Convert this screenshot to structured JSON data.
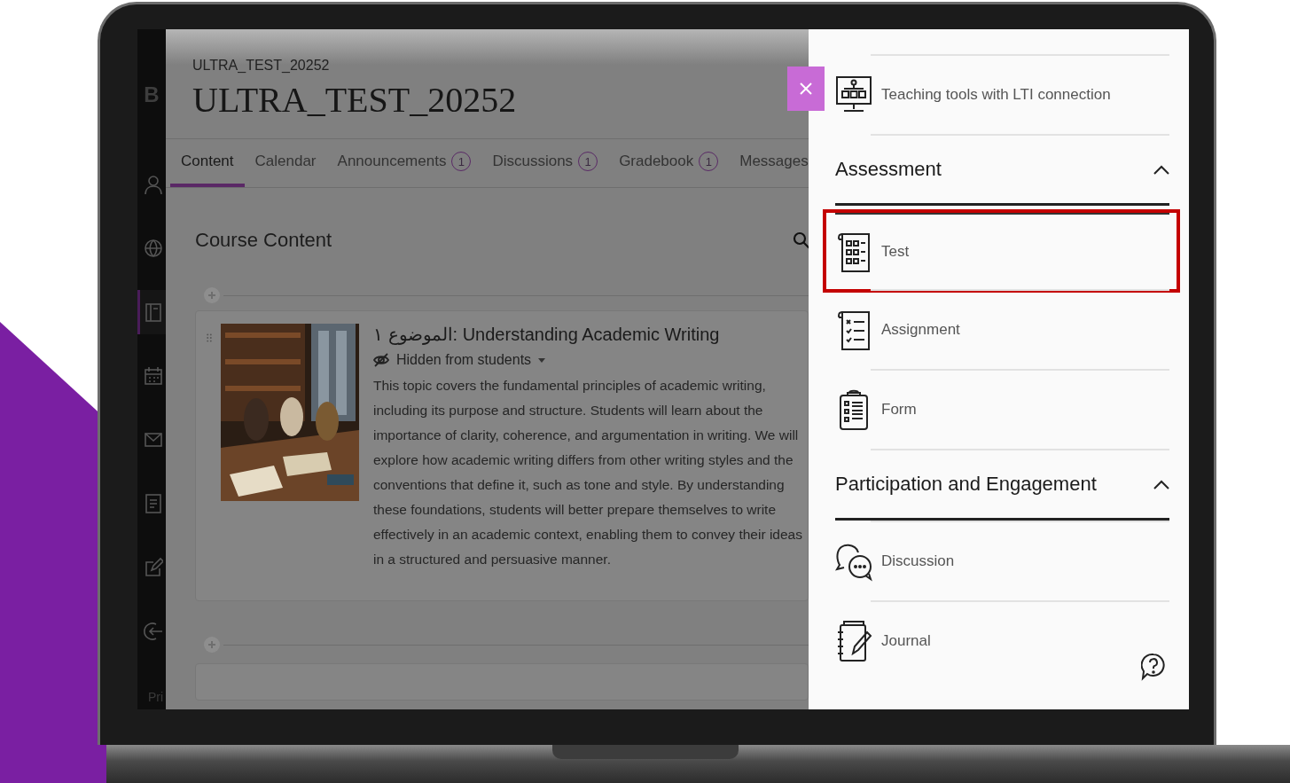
{
  "sidebar": {
    "logo": "B",
    "footer": "Pri",
    "items": [
      {
        "selected": false
      },
      {
        "selected": false
      },
      {
        "selected": true
      },
      {
        "selected": false
      },
      {
        "selected": false
      },
      {
        "selected": false
      },
      {
        "selected": false
      },
      {
        "selected": false
      }
    ]
  },
  "course": {
    "code": "ULTRA_TEST_20252",
    "title": "ULTRA_TEST_20252"
  },
  "tabs": [
    {
      "label": "Content",
      "selected": true
    },
    {
      "label": "Calendar",
      "selected": false
    },
    {
      "label": "Announcements",
      "badge": "1",
      "selected": false
    },
    {
      "label": "Discussions",
      "badge": "1",
      "selected": false
    },
    {
      "label": "Gradebook",
      "badge": "1",
      "selected": false
    },
    {
      "label": "Messages",
      "selected": false
    }
  ],
  "content": {
    "heading": "Course Content",
    "items": [
      {
        "title": "الموضوع ١: Understanding Academic Writing",
        "visibility": "Hidden from students",
        "description": "This topic covers the fundamental principles of academic writing, including its purpose and structure. Students will learn about the importance of clarity, coherence, and argumentation in writing. We will explore how academic writing differs from other writing styles and the conventions that define it, such as tone and style. By understanding these foundations, students will better prepare themselves to write effectively in an academic context, enabling them to convey their ideas in a structured and persuasive manner."
      }
    ]
  },
  "panel": {
    "rows": [
      {
        "kind": "item",
        "label": "Teaching tools with LTI connection",
        "highlighted": false
      },
      {
        "kind": "section",
        "label": "Assessment",
        "expanded": true
      },
      {
        "kind": "item",
        "label": "Test",
        "highlighted": true
      },
      {
        "kind": "item",
        "label": "Assignment",
        "highlighted": false
      },
      {
        "kind": "item",
        "label": "Form",
        "highlighted": false
      },
      {
        "kind": "section",
        "label": "Participation and Engagement",
        "expanded": true
      },
      {
        "kind": "item",
        "label": "Discussion",
        "highlighted": false
      },
      {
        "kind": "item",
        "label": "Journal",
        "highlighted": false
      }
    ]
  }
}
